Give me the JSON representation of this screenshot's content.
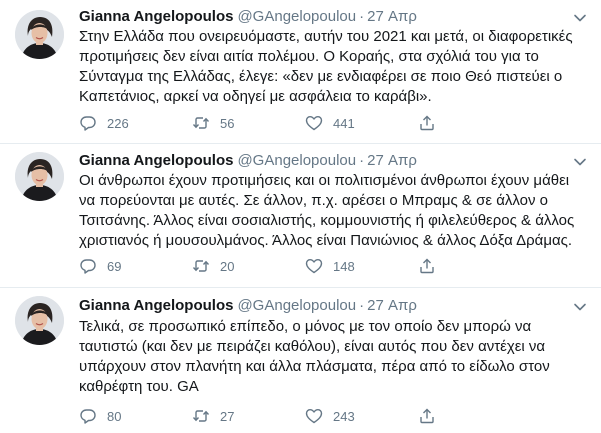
{
  "tweets": [
    {
      "author_name": "Gianna Angelopoulos",
      "handle": "@GAngelopoulou",
      "separator": "·",
      "date": "27 Απρ",
      "lines": [
        "Στην Ελλάδα που ονειρευόμαστε, αυτήν του 2021 και μετά, οι διαφορετικές",
        "προτιμήσεις δεν είναι αιτία πολέμου. Ο Κοραής, στα σχόλιά του για το",
        "Σύνταγμα της Ελλάδας, έλεγε: «δεν με ενδιαφέρει σε ποιο Θεό πιστεύει ο",
        "Καπετάνιος, αρκεί να οδηγεί με ασφάλεια το καράβι»."
      ],
      "replies": "226",
      "retweets": "56",
      "likes": "441"
    },
    {
      "author_name": "Gianna Angelopoulos",
      "handle": "@GAngelopoulou",
      "separator": "·",
      "date": "27 Απρ",
      "lines": [
        "Οι άνθρωποι έχουν προτιμήσεις και οι πολιτισμένοι άνθρωποι έχουν μάθει",
        "να πορεύονται με αυτές. Σε άλλον, π.χ. αρέσει ο Μπραμς & σε άλλον ο",
        "Τσιτσάνης. Άλλος είναι σοσιαλιστής, κομμουνιστής ή φιλελεύθερος & άλλος",
        "χριστιανός ή μουσουλμάνος. Άλλος είναι Πανιώνιος & άλλος Δόξα Δράμας."
      ],
      "replies": "69",
      "retweets": "20",
      "likes": "148"
    },
    {
      "author_name": "Gianna Angelopoulos",
      "handle": "@GAngelopoulou",
      "separator": "·",
      "date": "27 Απρ",
      "lines": [
        "Τελικά, σε προσωπικό επίπεδο, ο μόνος με τον οποίο δεν μπορώ να",
        "ταυτιστώ (και δεν με πειράζει καθόλου), είναι αυτός που δεν αντέχει να",
        "υπάρχουν στον πλανήτη και άλλα πλάσματα, πέρα από το είδωλο στον",
        "καθρέφτη του. GA"
      ],
      "replies": "80",
      "retweets": "27",
      "likes": "243"
    }
  ],
  "icons": {
    "reply": "reply-icon",
    "retweet": "retweet-icon",
    "like": "heart-icon",
    "share": "share-icon",
    "menu": "chevron-down-icon"
  },
  "colors": {
    "text": "#14171a",
    "secondary": "#657786",
    "divider": "#e6ecf0"
  }
}
